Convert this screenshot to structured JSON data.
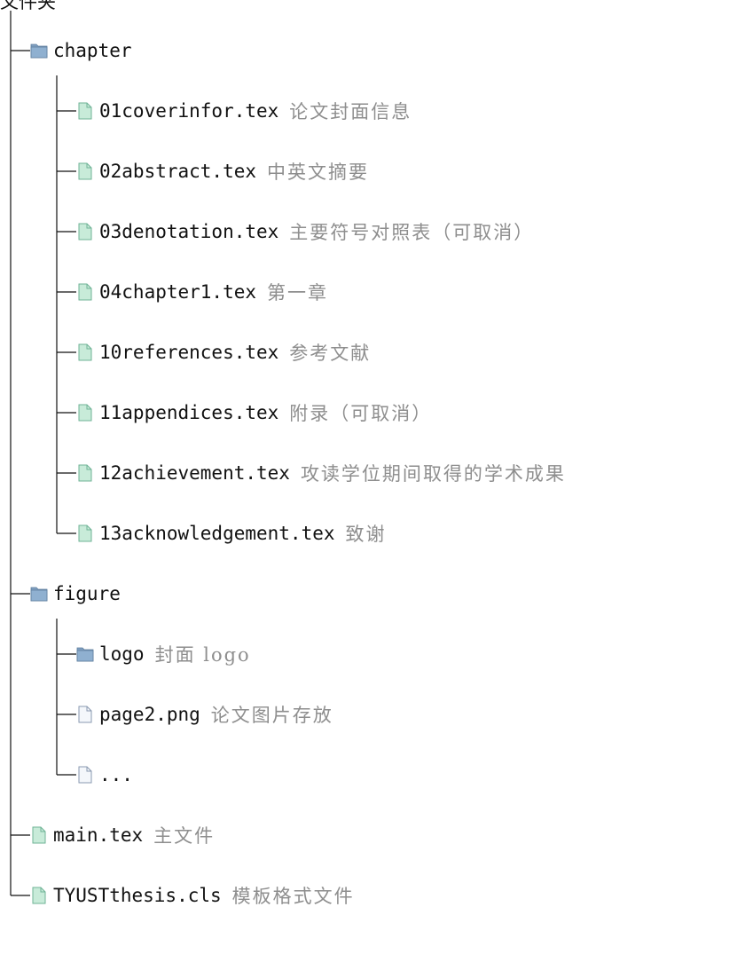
{
  "root": {
    "label": "文件夹"
  },
  "tree": [
    {
      "name": "chapter",
      "type": "folder",
      "children": [
        {
          "name": "01coverinfor.tex",
          "desc": "论文封面信息",
          "type": "tex"
        },
        {
          "name": "02abstract.tex",
          "desc": "中英文摘要",
          "type": "tex"
        },
        {
          "name": "03denotation.tex",
          "desc": "主要符号对照表（可取消）",
          "type": "tex"
        },
        {
          "name": "04chapter1.tex",
          "desc": "第一章",
          "type": "tex"
        },
        {
          "name": "10references.tex",
          "desc": "参考文献",
          "type": "tex"
        },
        {
          "name": "11appendices.tex",
          "desc": "附录（可取消）",
          "type": "tex"
        },
        {
          "name": "12achievement.tex",
          "desc": "攻读学位期间取得的学术成果",
          "type": "tex"
        },
        {
          "name": "13acknowledgement.tex",
          "desc": "致谢",
          "type": "tex"
        }
      ]
    },
    {
      "name": "figure",
      "type": "folder",
      "children": [
        {
          "name": "logo",
          "desc": "封面 logo",
          "type": "folder"
        },
        {
          "name": "page2.png",
          "desc": "论文图片存放",
          "type": "file"
        },
        {
          "name": "...",
          "desc": "",
          "type": "file"
        }
      ]
    },
    {
      "name": "main.tex",
      "desc": "主文件",
      "type": "tex"
    },
    {
      "name": "TYUSTthesis.cls",
      "desc": "模板格式文件",
      "type": "tex"
    }
  ],
  "colors": {
    "folder": "#7f9fc0",
    "tex_file": "#c8ebd9",
    "plain_file": "#f4f7fb",
    "line": "#111111",
    "desc": "#8e8e8e"
  }
}
